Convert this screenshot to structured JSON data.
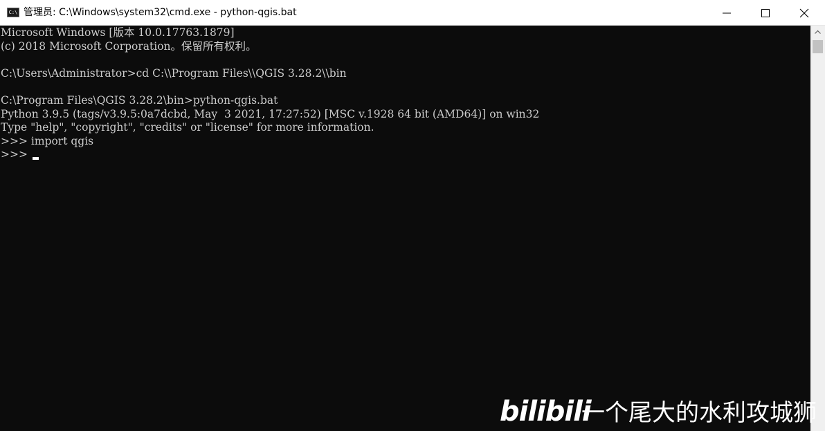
{
  "window": {
    "title": "管理员: C:\\Windows\\system32\\cmd.exe - python-qgis.bat",
    "icon": "cmd-console-icon",
    "icon_text": "C:\\"
  },
  "console": {
    "lines": [
      "Microsoft Windows [版本 10.0.17763.1879]",
      "(c) 2018 Microsoft Corporation。保留所有权利。",
      "",
      "C:\\Users\\Administrator>cd C:\\\\Program Files\\\\QGIS 3.28.2\\\\bin",
      "",
      "C:\\Program Files\\QGIS 3.28.2\\bin>python-qgis.bat",
      "Python 3.9.5 (tags/v3.9.5:0a7dcbd, May  3 2021, 17:27:52) [MSC v.1928 64 bit (AMD64)] on win32",
      "Type \"help\", \"copyright\", \"credits\" or \"license\" for more information.",
      ">>> import qgis",
      ">>> "
    ]
  },
  "watermark": {
    "logo": "bilibili",
    "text": "一个尾大的水利攻城狮"
  },
  "colors": {
    "console_bg": "#0c0c0c",
    "console_fg": "#cccccc",
    "titlebar_bg": "#ffffff"
  }
}
